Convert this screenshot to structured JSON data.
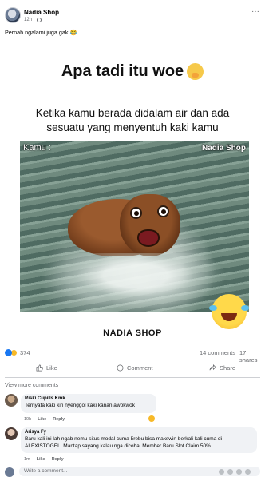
{
  "post": {
    "page_name": "Nadia Shop",
    "time": "12h ·",
    "caption": "Pernah ngalami juga gak 😂"
  },
  "meme": {
    "title": "Apa tadi itu woe",
    "subtitle_line1": "Ketika kamu berada didalam air dan ada",
    "subtitle_line2": "sesuatu yang menyentuh kaki kamu",
    "photo_label": "Kamu :",
    "watermark": "Nadia Shop",
    "footer": "NADIA SHOP"
  },
  "stats": {
    "reactions": "374",
    "comments": "14 comments",
    "shares": "17 shares"
  },
  "actions": {
    "like": "Like",
    "comment": "Comment",
    "share": "Share"
  },
  "view_more": "View more comments",
  "comments": [
    {
      "name": "Riski Cupills Kmk",
      "text": "Ternyata kaki kiri nyenggol kaki kanan awokwok",
      "time": "10h",
      "like": "Like",
      "reply": "Reply"
    },
    {
      "name": "Arisya Fy",
      "text": "Baru kali ini lah ngab nemu situs modal cuma 5rebu bisa makswin berkali kali cuma di ALEXISTOGEL. Mantap sayang kalau nga dicoba. Member Baru Slot Claim 50%",
      "time": "1m",
      "like": "Like",
      "reply": "Reply"
    }
  ],
  "write_comment": {
    "placeholder": "Write a comment..."
  },
  "colors": {
    "accent": "#1877f2",
    "muted": "#65676b",
    "bubble": "#f0f2f5"
  }
}
